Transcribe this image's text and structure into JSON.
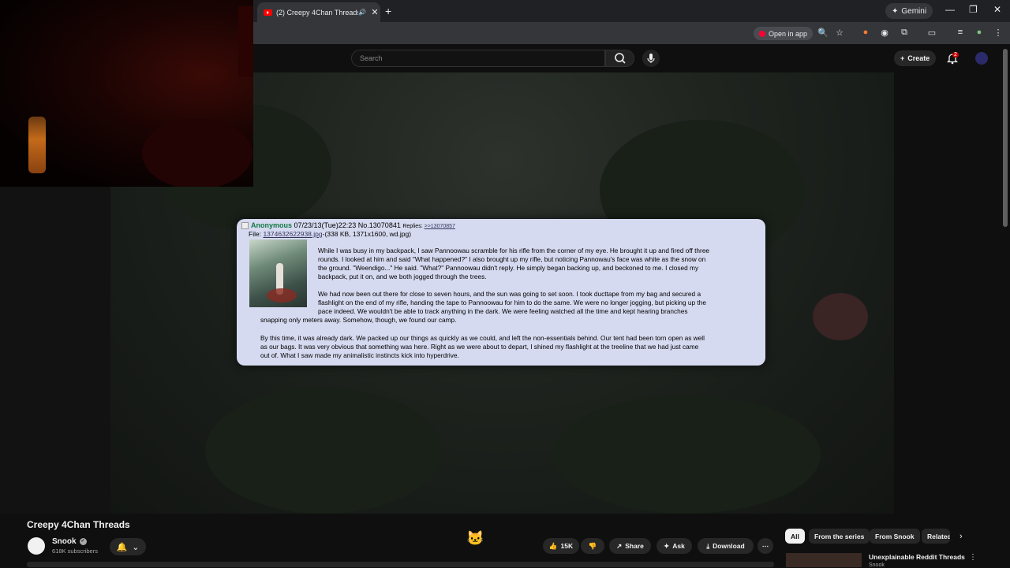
{
  "browser": {
    "tab_title": "(2) Creepy 4Chan Threads",
    "tab_close": "✕",
    "new_tab": "+",
    "gemini_label": "Gemini",
    "open_in_app": "Open in app",
    "window_controls": [
      "—",
      "❐",
      "✕"
    ]
  },
  "youtube": {
    "search_placeholder": "Search",
    "create_label": "Create",
    "notification_count": "2"
  },
  "post": {
    "name": "Anonymous",
    "datetime": "07/23/13(Tue)22:23",
    "post_no": "No.13070841",
    "replies_label": "Replies:",
    "reply_link": ">>13070857",
    "file_label": "File:",
    "file_link": "1374632622938.jpg",
    "file_meta": "-(338 KB, 1371x1600, wd.jpg)",
    "para1_lines": [
      "While I was busy in my backpack, I saw Pannoowau scramble for his rifle from the corner of my eye. He brought it up and fired off three",
      "rounds. I looked at him and said \"What happened?\" I also brought up my rifle, but noticing Pannowau's face was white as the snow on",
      "the ground. \"Weendigo...\" He said. \"What?\" Pannoowau didn't reply. He simply began backing up, and beckoned to me. I closed my",
      "backpack, put it on, and we both jogged through the trees."
    ],
    "para2_lines": [
      "We had now been out there for close to seven hours, and the sun was going to set soon. I took ducttape from my bag and secured a",
      "flashlight on the end of my rifle, handing the tape to Pannoowau for him to do the same. We were no longer jogging, but picking up the",
      "pace indeed. We wouldn't be able to track anything in the dark. We were feeling watched all the time and kept hearing branches",
      "snapping only meters away. Somehow, though, we found our camp."
    ],
    "para3_lines": [
      "By this time, it was already dark. We packed up our things as quickly as we could, and left the non-essentials behind. Our tent had been torn open as well",
      "as our bags. It was very obvious that something was here. Right as we were about to depart, I shined my flashlight at the treeline that we had just came",
      "out of. What I saw made my animalistic instincts kick into hyperdrive."
    ]
  },
  "video": {
    "title": "Creepy 4Chan Threads",
    "channel": "Snook",
    "subscribers": "618K subscribers",
    "likes": "15K",
    "share": "Share",
    "ask": "Ask",
    "download": "Download"
  },
  "chips": [
    "All",
    "From the series",
    "From Snook",
    "Related"
  ],
  "related": {
    "title": "Unexplainable Reddit Threads",
    "channel": "Snook"
  },
  "colors": {
    "post_bg": "#d6daf0",
    "name_green": "#117743",
    "link": "#34345c",
    "yt_red": "#ff0000"
  }
}
